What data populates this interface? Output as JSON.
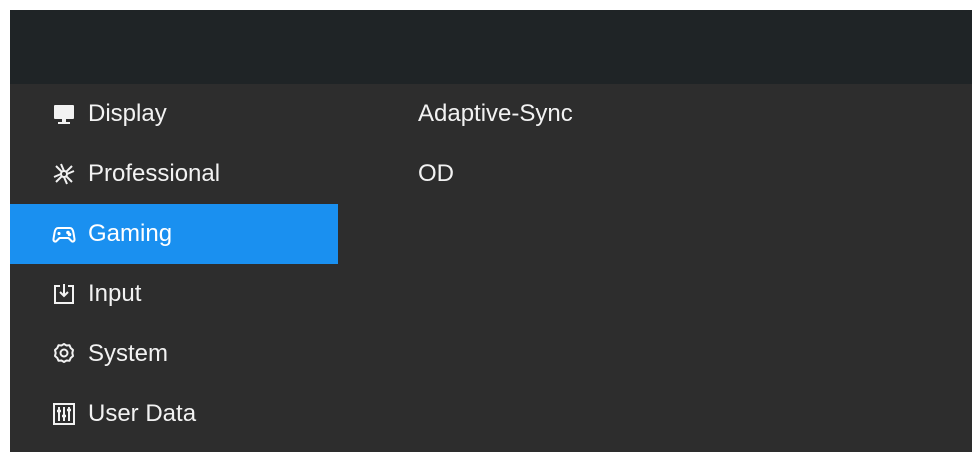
{
  "menu": {
    "items": [
      {
        "label": "Display",
        "icon": "monitor-icon"
      },
      {
        "label": "Professional",
        "icon": "aperture-icon"
      },
      {
        "label": "Gaming",
        "icon": "gamepad-icon",
        "selected": true
      },
      {
        "label": "Input",
        "icon": "input-icon"
      },
      {
        "label": "System",
        "icon": "gear-icon"
      },
      {
        "label": "User Data",
        "icon": "sliders-icon"
      }
    ]
  },
  "submenu": {
    "items": [
      {
        "label": "Adaptive-Sync"
      },
      {
        "label": "OD"
      }
    ]
  },
  "colors": {
    "header": "#1f2426",
    "panel": "#2d2d2d",
    "selected": "#1a90f0",
    "text": "#f2f2f2"
  }
}
